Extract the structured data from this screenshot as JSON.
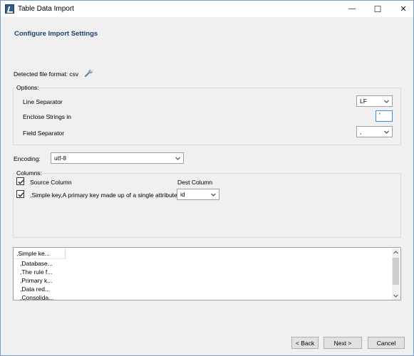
{
  "window": {
    "title": "Table Data Import",
    "controls": {
      "minimize": "—",
      "maximize": "☐",
      "close": "✕"
    }
  },
  "page": {
    "title": "Configure Import Settings",
    "detected_format_label": "Detected file format: csv"
  },
  "options": {
    "legend": "Options:",
    "line_separator_label": "Line Separator",
    "line_separator_value": "LF",
    "enclose_label": "Enclose Strings in",
    "enclose_value": "'",
    "field_separator_label": "Field Separator",
    "field_separator_value": ","
  },
  "encoding": {
    "label": "Encoding:",
    "value": "utf-8"
  },
  "columns": {
    "legend": "Columns:",
    "source_header": "Source Column",
    "dest_header": "Dest Column",
    "header_checked": true,
    "rows": [
      {
        "source": ",Simple key,A primary key made up of a single attribute",
        "dest": "id",
        "checked": true
      }
    ]
  },
  "preview": {
    "header": ",Simple ke...",
    "items": [
      ",Database...",
      ",The rule f...",
      ",Primary k...",
      ",Data red...",
      ",Consolida..."
    ]
  },
  "buttons": {
    "back": "< Back",
    "next": "Next >",
    "cancel": "Cancel"
  },
  "colors": {
    "title_blue": "#1f3f6e",
    "focus_blue": "#3a8ee6"
  }
}
